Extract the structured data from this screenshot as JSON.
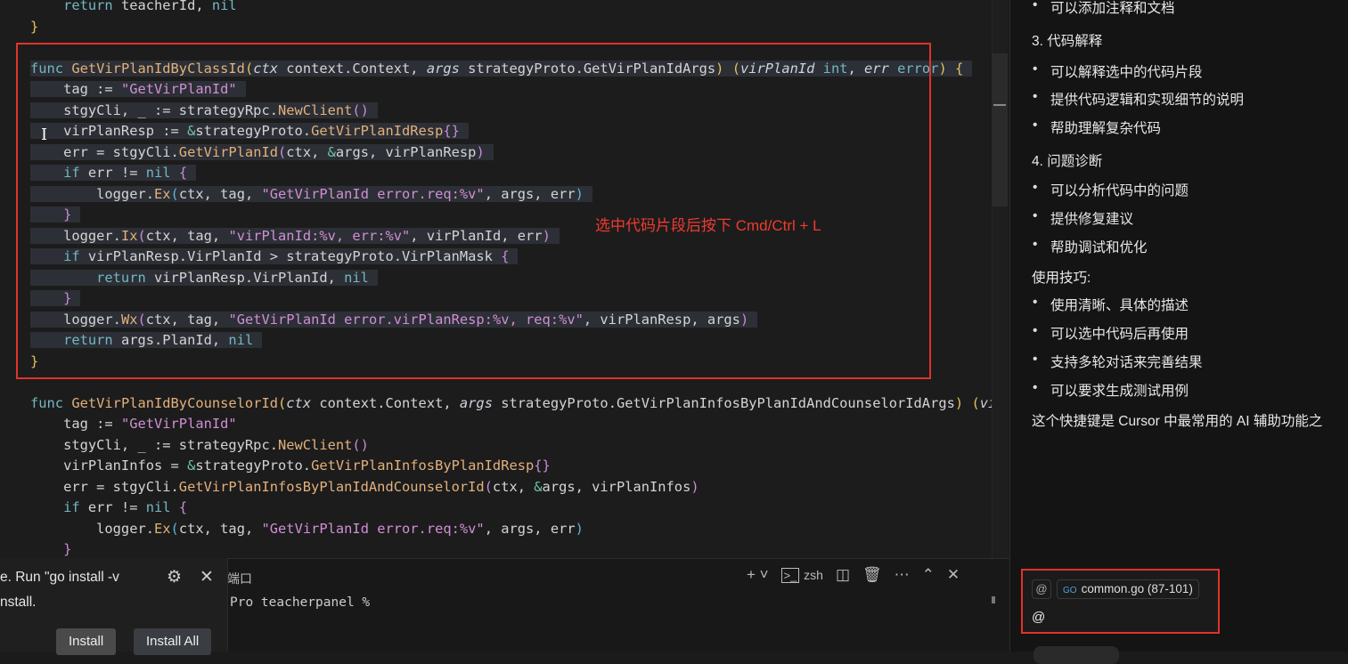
{
  "editor": {
    "lines": [
      {
        "sel": false,
        "t": [
          [
            "o",
            "    "
          ],
          [
            "k",
            "return"
          ],
          [
            "o",
            " teacherId, "
          ],
          [
            "k",
            "nil"
          ]
        ]
      },
      {
        "sel": false,
        "t": [
          [
            "b",
            "}"
          ]
        ]
      },
      {
        "sel": false,
        "t": []
      },
      {
        "sel": true,
        "t": [
          [
            "k",
            "func "
          ],
          [
            "f",
            "GetVirPlanIdByClassId"
          ],
          [
            "b",
            "("
          ],
          [
            "p",
            "ctx"
          ],
          [
            "o",
            " context.Context, "
          ],
          [
            "p",
            "args"
          ],
          [
            "o",
            " strategyProto.GetVirPlanIdArgs"
          ],
          [
            "b",
            ")"
          ],
          [
            "o",
            " "
          ],
          [
            "b",
            "("
          ],
          [
            "p",
            "virPlanId"
          ],
          [
            "k",
            " int"
          ],
          [
            "o",
            ", "
          ],
          [
            "p",
            "err"
          ],
          [
            "k",
            " error"
          ],
          [
            "b",
            ")"
          ],
          [
            "o",
            " "
          ],
          [
            "b",
            "{"
          ]
        ]
      },
      {
        "sel": true,
        "t": [
          [
            "o",
            "    tag := "
          ],
          [
            "s",
            "\"GetVirPlanId\""
          ]
        ]
      },
      {
        "sel": true,
        "t": [
          [
            "o",
            "    stgyCli, _ := strategyRpc."
          ],
          [
            "f",
            "NewClient"
          ],
          [
            "bp",
            "()"
          ]
        ]
      },
      {
        "sel": true,
        "t": [
          [
            "o",
            "    virPlanResp := "
          ],
          [
            "a",
            "&"
          ],
          [
            "o",
            "strategyProto."
          ],
          [
            "f",
            "GetVirPlanIdResp"
          ],
          [
            "bp",
            "{}"
          ]
        ]
      },
      {
        "sel": true,
        "t": [
          [
            "o",
            "    err = stgyCli."
          ],
          [
            "f",
            "GetVirPlanId"
          ],
          [
            "bp",
            "("
          ],
          [
            "o",
            "ctx, "
          ],
          [
            "a",
            "&"
          ],
          [
            "o",
            "args, virPlanResp"
          ],
          [
            "bp",
            ")"
          ]
        ]
      },
      {
        "sel": true,
        "t": [
          [
            "k",
            "    if"
          ],
          [
            "o",
            " err != "
          ],
          [
            "k",
            "nil"
          ],
          [
            "o",
            " "
          ],
          [
            "bp",
            "{"
          ]
        ]
      },
      {
        "sel": true,
        "t": [
          [
            "o",
            "        logger."
          ],
          [
            "f",
            "Ex"
          ],
          [
            "bb",
            "("
          ],
          [
            "o",
            "ctx, tag, "
          ],
          [
            "s",
            "\"GetVirPlanId error.req:%v\""
          ],
          [
            "o",
            ", args, err"
          ],
          [
            "bb",
            ")"
          ]
        ]
      },
      {
        "sel": true,
        "t": [
          [
            "bp",
            "    }"
          ]
        ]
      },
      {
        "sel": true,
        "t": [
          [
            "o",
            "    logger."
          ],
          [
            "f",
            "Ix"
          ],
          [
            "bp",
            "("
          ],
          [
            "o",
            "ctx, tag, "
          ],
          [
            "s",
            "\"virPlanId:%v, err:%v\""
          ],
          [
            "o",
            ", virPlanId, err"
          ],
          [
            "bp",
            ")"
          ]
        ]
      },
      {
        "sel": true,
        "t": [
          [
            "k",
            "    if"
          ],
          [
            "o",
            " virPlanResp.VirPlanId > strategyProto.VirPlanMask "
          ],
          [
            "bp",
            "{"
          ]
        ]
      },
      {
        "sel": true,
        "t": [
          [
            "k",
            "        return"
          ],
          [
            "o",
            " virPlanResp.VirPlanId, "
          ],
          [
            "k",
            "nil"
          ]
        ]
      },
      {
        "sel": true,
        "t": [
          [
            "bp",
            "    }"
          ]
        ]
      },
      {
        "sel": true,
        "t": [
          [
            "o",
            "    logger."
          ],
          [
            "f",
            "Wx"
          ],
          [
            "bp",
            "("
          ],
          [
            "o",
            "ctx, tag, "
          ],
          [
            "s",
            "\"GetVirPlanId error.virPlanResp:%v, req:%v\""
          ],
          [
            "o",
            ", virPlanResp, args"
          ],
          [
            "bp",
            ")"
          ]
        ]
      },
      {
        "sel": true,
        "t": [
          [
            "k",
            "    return"
          ],
          [
            "o",
            " args.PlanId, "
          ],
          [
            "k",
            "nil"
          ]
        ]
      },
      {
        "sel": false,
        "t": [
          [
            "b",
            "}"
          ]
        ]
      },
      {
        "sel": false,
        "t": []
      },
      {
        "sel": false,
        "t": [
          [
            "k",
            "func "
          ],
          [
            "f",
            "GetVirPlanIdByCounselorId"
          ],
          [
            "b",
            "("
          ],
          [
            "p",
            "ctx"
          ],
          [
            "o",
            " context.Context, "
          ],
          [
            "p",
            "args"
          ],
          [
            "o",
            " strategyProto.GetVirPlanInfosByPlanIdAndCounselorIdArgs"
          ],
          [
            "b",
            ")"
          ],
          [
            "o",
            " "
          ],
          [
            "b",
            "("
          ],
          [
            "p",
            "vi"
          ]
        ]
      },
      {
        "sel": false,
        "t": [
          [
            "o",
            "    tag := "
          ],
          [
            "s",
            "\"GetVirPlanId\""
          ]
        ]
      },
      {
        "sel": false,
        "t": [
          [
            "o",
            "    stgyCli, _ := strategyRpc."
          ],
          [
            "f",
            "NewClient"
          ],
          [
            "bp",
            "()"
          ]
        ]
      },
      {
        "sel": false,
        "t": [
          [
            "o",
            "    virPlanInfos = "
          ],
          [
            "a",
            "&"
          ],
          [
            "o",
            "strategyProto."
          ],
          [
            "f",
            "GetVirPlanInfosByPlanIdResp"
          ],
          [
            "bp",
            "{}"
          ]
        ]
      },
      {
        "sel": false,
        "t": [
          [
            "o",
            "    err = stgyCli."
          ],
          [
            "f",
            "GetVirPlanInfosByPlanIdAndCounselorId"
          ],
          [
            "bp",
            "("
          ],
          [
            "o",
            "ctx, "
          ],
          [
            "a",
            "&"
          ],
          [
            "o",
            "args, virPlanInfos"
          ],
          [
            "bp",
            ")"
          ]
        ]
      },
      {
        "sel": false,
        "t": [
          [
            "k",
            "    if"
          ],
          [
            "o",
            " err != "
          ],
          [
            "k",
            "nil"
          ],
          [
            "o",
            " "
          ],
          [
            "bp",
            "{"
          ]
        ]
      },
      {
        "sel": false,
        "t": [
          [
            "o",
            "        logger."
          ],
          [
            "f",
            "Ex"
          ],
          [
            "bb",
            "("
          ],
          [
            "o",
            "ctx, tag, "
          ],
          [
            "s",
            "\"GetVirPlanId error.req:%v\""
          ],
          [
            "o",
            ", args, err"
          ],
          [
            "bb",
            ")"
          ]
        ]
      },
      {
        "sel": false,
        "t": [
          [
            "bp",
            "    }"
          ]
        ]
      }
    ],
    "annotation": "选中代码片段后按下 Cmd/Ctrl + L"
  },
  "popup": {
    "line1": "e. Run \"go install -v",
    "line2": "nstall.",
    "install": "Install",
    "install_all": "Install All"
  },
  "terminal": {
    "tab": "端口",
    "prompt": "Pro teacherpanel %",
    "shell": "zsh"
  },
  "chat": {
    "items": [
      {
        "type": "bullet",
        "text": "可以添加注释和文档"
      },
      {
        "type": "heading",
        "text": "3. 代码解释"
      },
      {
        "type": "bullet",
        "text": "可以解释选中的代码片段"
      },
      {
        "type": "bullet",
        "text": "提供代码逻辑和实现细节的说明"
      },
      {
        "type": "bullet",
        "text": "帮助理解复杂代码"
      },
      {
        "type": "heading",
        "text": "4. 问题诊断"
      },
      {
        "type": "bullet",
        "text": "可以分析代码中的问题"
      },
      {
        "type": "bullet",
        "text": "提供修复建议"
      },
      {
        "type": "bullet",
        "text": "帮助调试和优化"
      },
      {
        "type": "heading",
        "text": "使用技巧:"
      },
      {
        "type": "bullet",
        "text": "使用清晰、具体的描述"
      },
      {
        "type": "bullet",
        "text": "可以选中代码后再使用"
      },
      {
        "type": "bullet",
        "text": "支持多轮对话来完善结果"
      },
      {
        "type": "bullet",
        "text": "可以要求生成测试用例"
      },
      {
        "type": "heading",
        "text": "这个快捷键是 Cursor 中最常用的 AI 辅助功能之"
      }
    ],
    "input": {
      "at_chip": "@",
      "file_chip": "common.go (87-101)",
      "value": "@"
    }
  }
}
